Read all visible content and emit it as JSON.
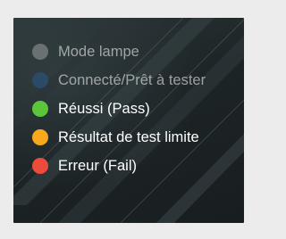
{
  "legend": {
    "items": [
      {
        "label": "Mode lampe",
        "color": "#9a9ea0",
        "state": "dimmed"
      },
      {
        "label": "Connecté/Prêt à tester",
        "color": "#2a5a8a",
        "state": "dimmed"
      },
      {
        "label": "Réussi (Pass)",
        "color": "#5cc63a",
        "state": "active"
      },
      {
        "label": "Résultat de test limite",
        "color": "#f7a81b",
        "state": "active"
      },
      {
        "label": "Erreur (Fail)",
        "color": "#ef4b3a",
        "state": "active"
      }
    ]
  }
}
